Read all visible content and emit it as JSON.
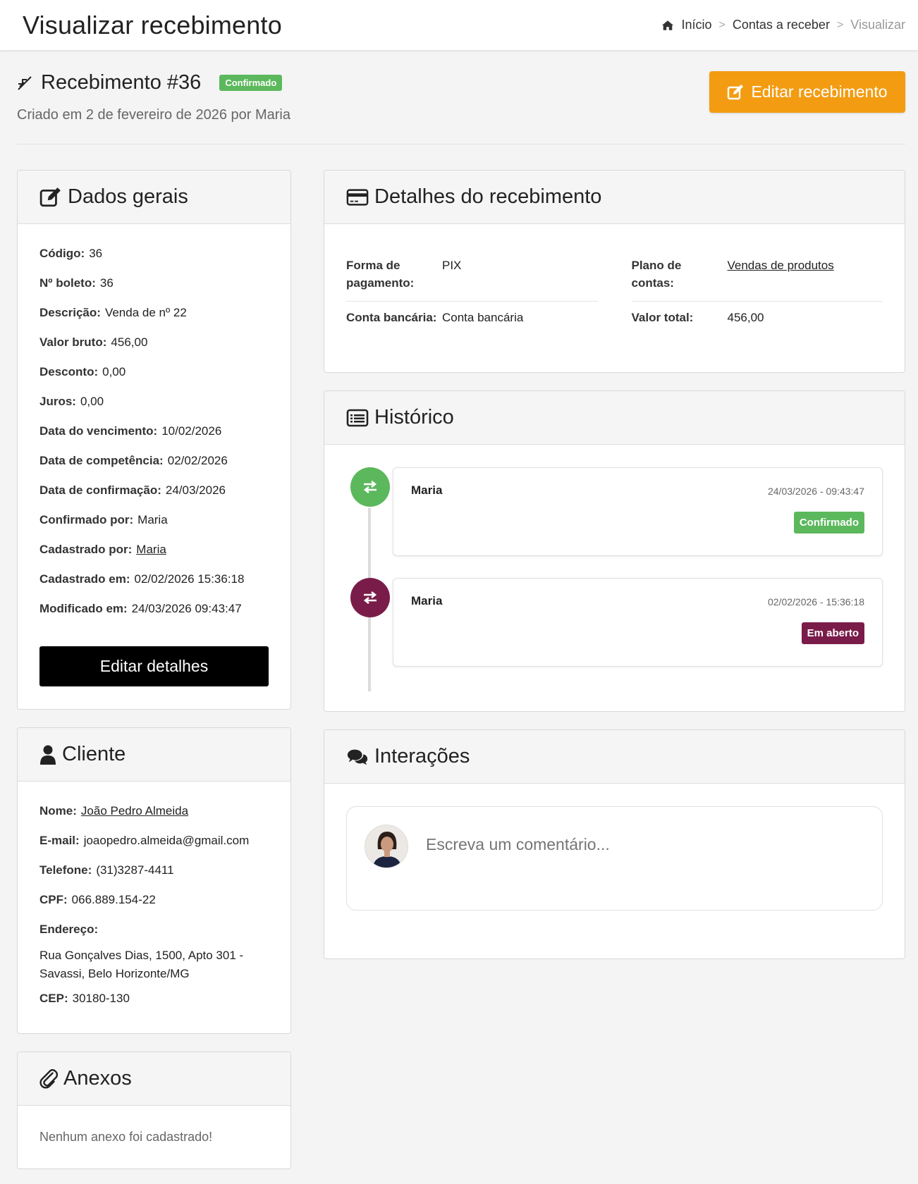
{
  "topbar": {
    "title": "Visualizar recebimento",
    "breadcrumb": {
      "home": "Início",
      "parent": "Contas a receber",
      "current": "Visualizar"
    }
  },
  "header": {
    "title": "Recebimento #36",
    "status": "Confirmado",
    "subtitle": "Criado em 2 de fevereiro de 2026 por Maria",
    "edit_button": "Editar recebimento"
  },
  "dados_gerais": {
    "title": "Dados gerais",
    "rows": [
      {
        "label": "Código:",
        "value": "36"
      },
      {
        "label": "Nº boleto:",
        "value": "36"
      },
      {
        "label": "Descrição:",
        "value": "Venda de nº 22"
      },
      {
        "label": "Valor bruto:",
        "value": "456,00"
      },
      {
        "label": "Desconto:",
        "value": "0,00"
      },
      {
        "label": "Juros:",
        "value": "0,00"
      },
      {
        "label": "Data do vencimento:",
        "value": "10/02/2026"
      },
      {
        "label": "Data de competência:",
        "value": "02/02/2026"
      },
      {
        "label": "Data de confirmação:",
        "value": "24/03/2026"
      },
      {
        "label": "Confirmado por:",
        "value": "Maria"
      },
      {
        "label": "Cadastrado por:",
        "value": "Maria"
      },
      {
        "label": "Cadastrado em:",
        "value": "02/02/2026 15:36:18"
      },
      {
        "label": "Modificado em:",
        "value": "24/03/2026 09:43:47"
      }
    ],
    "edit_button": "Editar detalhes"
  },
  "detalhes": {
    "title": "Detalhes do recebimento",
    "forma_label": "Forma de pagamento:",
    "forma_value": "PIX",
    "plano_label": "Plano de contas:",
    "plano_value": "Vendas de produtos",
    "conta_label": "Conta bancária:",
    "conta_value": "Conta bancária",
    "valor_label": "Valor total:",
    "valor_value": "456,00"
  },
  "historico": {
    "title": "Histórico",
    "items": [
      {
        "user": "Maria",
        "datetime": "24/03/2026 - 09:43:47",
        "status": "Confirmado",
        "color": "#5cb85c"
      },
      {
        "user": "Maria",
        "datetime": "02/02/2026 - 15:36:18",
        "status": "Em aberto",
        "color": "#7a1c4a"
      }
    ]
  },
  "interacoes": {
    "title": "Interações",
    "placeholder": "Escreva um comentário..."
  },
  "cliente": {
    "title": "Cliente",
    "nome_label": "Nome:",
    "nome_value": "João Pedro Almeida",
    "email_label": "E-mail:",
    "email_value": "joaopedro.almeida@gmail.com",
    "telefone_label": "Telefone:",
    "telefone_value": "(31)3287-4411",
    "cpf_label": "CPF:",
    "cpf_value": "066.889.154-22",
    "endereco_label": "Endereço:",
    "endereco_line1": "Rua Gonçalves Dias, 1500, Apto 301 -",
    "endereco_line2": "Savassi, Belo Horizonte/MG",
    "cep_label": "CEP:",
    "cep_value": "30180-130"
  },
  "anexos": {
    "title": "Anexos",
    "empty": "Nenhum anexo foi cadastrado!"
  },
  "colors": {
    "orange": "#f39c12",
    "green": "#5cb85c",
    "wine": "#7a1c4a"
  }
}
